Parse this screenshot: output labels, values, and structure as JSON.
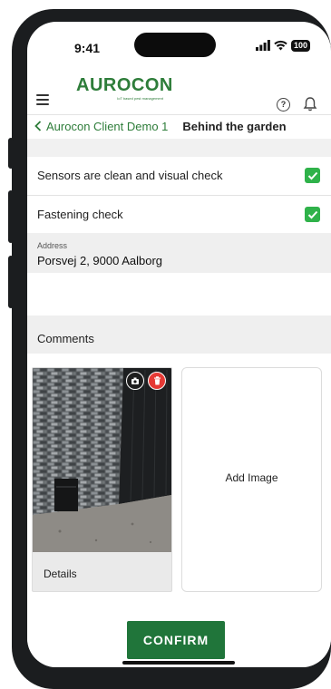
{
  "status_bar": {
    "time": "9:41",
    "battery": "100"
  },
  "header": {
    "logo_text": "AUROCON",
    "logo_tagline": "IoT based pest management"
  },
  "breadcrumb": {
    "parent": "Aurocon Client Demo 1",
    "current": "Behind the garden"
  },
  "checks": [
    {
      "label": "Sensors are clean and visual check",
      "checked": true
    },
    {
      "label": "Fastening check",
      "checked": true
    }
  ],
  "address": {
    "label": "Address",
    "value": "Porsvej 2, 9000 Aalborg"
  },
  "comments": {
    "label": "Comments"
  },
  "images": {
    "photo_caption": "Details",
    "add_label": "Add Image"
  },
  "footer": {
    "confirm_label": "CONFIRM"
  },
  "colors": {
    "brand_green": "#2e7d3a",
    "checkbox_green": "#2fb24a",
    "confirm_green": "#20753a",
    "delete_red": "#e53935"
  }
}
